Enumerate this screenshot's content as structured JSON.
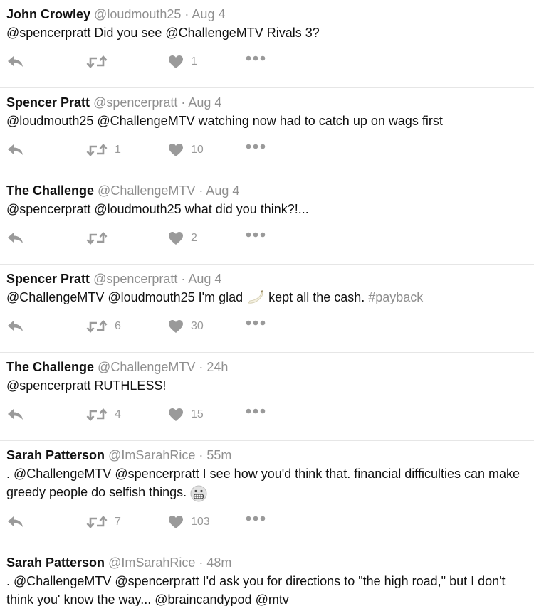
{
  "tweets": [
    {
      "name": "John Crowley",
      "handle": "@loudmouth25",
      "sep": " · ",
      "time": "Aug 4",
      "segments": [
        {
          "t": "@spencerpratt Did you see @ChallengeMTV Rivals 3?"
        }
      ],
      "retweets": "",
      "likes": "1"
    },
    {
      "name": "Spencer Pratt",
      "handle": "@spencerpratt",
      "sep": " · ",
      "time": "Aug 4",
      "segments": [
        {
          "t": "@loudmouth25 @ChallengeMTV watching now had to catch up on wags first"
        }
      ],
      "retweets": "1",
      "likes": "10"
    },
    {
      "name": "The Challenge",
      "handle": "@ChallengeMTV",
      "sep": " · ",
      "time": "Aug 4",
      "segments": [
        {
          "t": "@spencerpratt @loudmouth25 what did you think?!..."
        }
      ],
      "retweets": "",
      "likes": "2"
    },
    {
      "name": "Spencer Pratt",
      "handle": "@spencerpratt",
      "sep": " · ",
      "time": "Aug 4",
      "segments": [
        {
          "t": "@ChallengeMTV @loudmouth25 I'm glad "
        },
        {
          "emoji": "banana"
        },
        {
          "t": " kept all the cash. "
        },
        {
          "t": " #payback",
          "c": "#8f8f8f"
        }
      ],
      "retweets": "6",
      "likes": "30"
    },
    {
      "name": "The Challenge",
      "handle": "@ChallengeMTV",
      "sep": " · ",
      "time": "24h",
      "segments": [
        {
          "t": "@spencerpratt RUTHLESS!"
        }
      ],
      "retweets": "4",
      "likes": "15"
    },
    {
      "name": "Sarah Patterson",
      "handle": "@ImSarahRice",
      "sep": " · ",
      "time": "55m",
      "segments": [
        {
          "t": ". @ChallengeMTV @spencerpratt I see how you'd think that. financial difficulties can make greedy people do selfish things. "
        },
        {
          "emoji": "grimace"
        }
      ],
      "retweets": "7",
      "likes": "103"
    },
    {
      "name": "Sarah Patterson",
      "handle": "@ImSarahRice",
      "sep": " · ",
      "time": "48m",
      "segments": [
        {
          "t": ". @ChallengeMTV @spencerpratt I'd ask you for directions to \"the high road,\" but I don't think you' know the way... @braincandypod @mtv"
        }
      ],
      "retweets": "",
      "likes": "",
      "no_actions": true
    }
  ],
  "colors": {
    "text": "#111111",
    "muted": "#8f8f8f",
    "icon": "#9a9a9a",
    "divider": "#e6e6e6"
  },
  "icons": {
    "reply": "reply-icon",
    "retweet": "retweet-icon",
    "like": "heart-icon",
    "more": "more-dots-icon"
  }
}
